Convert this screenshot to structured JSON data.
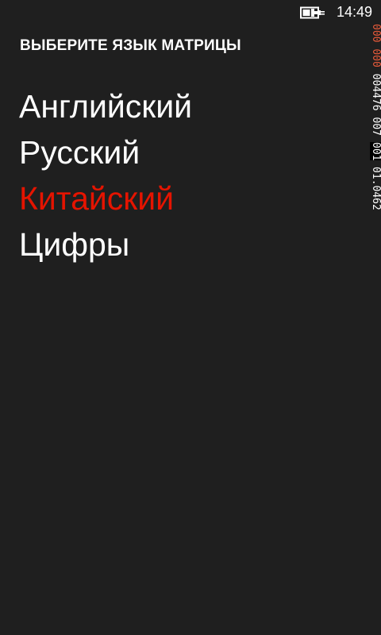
{
  "status_bar": {
    "time": "14:49",
    "battery_icon": "battery-charging-icon"
  },
  "page": {
    "title": "ВЫБЕРИТЕ ЯЗЫК МАТРИЦЫ"
  },
  "languages": [
    {
      "label": "Английский",
      "selected": false
    },
    {
      "label": "Русский",
      "selected": false
    },
    {
      "label": "Китайский",
      "selected": true
    },
    {
      "label": "Цифры",
      "selected": false
    }
  ],
  "debug_counter": {
    "seg1": "000",
    "seg2": "000",
    "seg3": "004476",
    "seg4": "007",
    "seg5": "001",
    "seg6": "01.0462"
  },
  "colors": {
    "background": "#1f1f1f",
    "accent": "#e51400",
    "text": "#ffffff"
  }
}
